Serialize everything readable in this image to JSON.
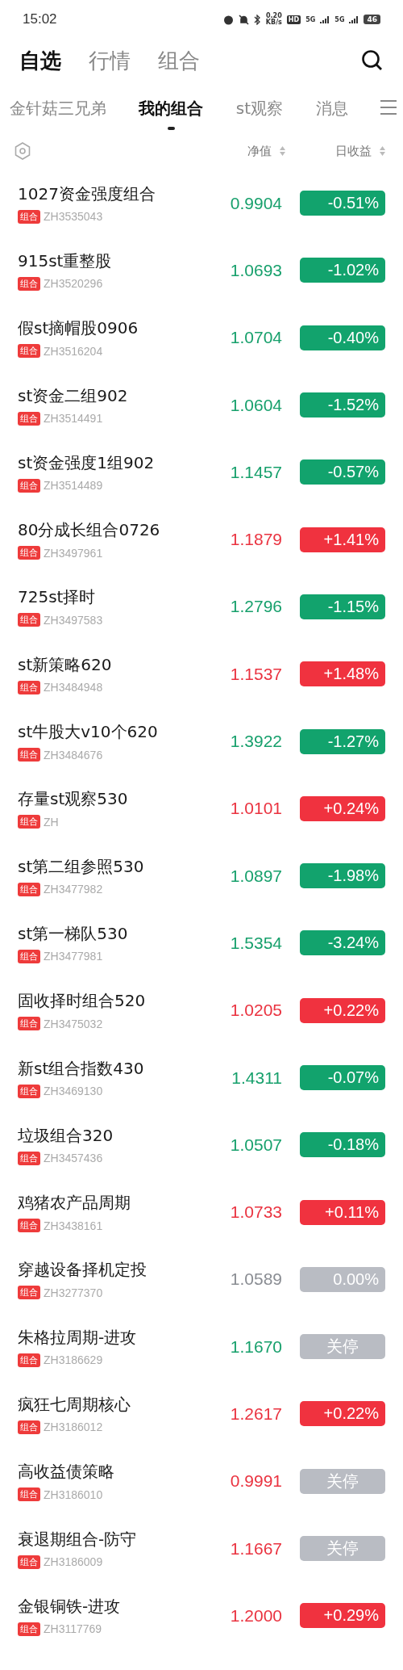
{
  "status_bar": {
    "time": "15:02",
    "speed": "0.20",
    "speed_unit": "KB/s",
    "hd": "HD",
    "sim1": "5G",
    "sim2": "5G",
    "battery": "46"
  },
  "main_tabs": [
    {
      "label": "自选",
      "selected": true
    },
    {
      "label": "行情",
      "selected": false
    },
    {
      "label": "组合",
      "selected": false
    }
  ],
  "sub_tabs": [
    {
      "label": "金针菇三兄弟",
      "selected": false
    },
    {
      "label": "我的组合",
      "selected": true
    },
    {
      "label": "st观察",
      "selected": false
    },
    {
      "label": "消息",
      "selected": false
    }
  ],
  "columns": [
    "净值",
    "日收益"
  ],
  "rows": [
    {
      "name": "1027资金强度组合",
      "tag": "组合",
      "code": "ZH3535043",
      "nav": {
        "text": "0.9904",
        "color": "#17a06c"
      },
      "change": {
        "text": "-0.51%",
        "color": "#12a36d",
        "halted": false
      }
    },
    {
      "name": "915st重整股",
      "tag": "组合",
      "code": "ZH3520296",
      "nav": {
        "text": "1.0693",
        "color": "#17a06c"
      },
      "change": {
        "text": "-1.02%",
        "color": "#12a36d",
        "halted": false
      }
    },
    {
      "name": "假st摘帽股0906",
      "tag": "组合",
      "code": "ZH3516204",
      "nav": {
        "text": "1.0704",
        "color": "#17a06c"
      },
      "change": {
        "text": "-0.40%",
        "color": "#12a36d",
        "halted": false
      }
    },
    {
      "name": "st资金二组902",
      "tag": "组合",
      "code": "ZH3514491",
      "nav": {
        "text": "1.0604",
        "color": "#17a06c"
      },
      "change": {
        "text": "-1.52%",
        "color": "#12a36d",
        "halted": false
      }
    },
    {
      "name": "st资金强度1组902",
      "tag": "组合",
      "code": "ZH3514489",
      "nav": {
        "text": "1.1457",
        "color": "#17a06c"
      },
      "change": {
        "text": "-0.57%",
        "color": "#12a36d",
        "halted": false
      }
    },
    {
      "name": "80分成长组合0726",
      "tag": "组合",
      "code": "ZH3497961",
      "nav": {
        "text": "1.1879",
        "color": "#ea3340"
      },
      "change": {
        "text": "+1.41%",
        "color": "#f0323f",
        "halted": false
      }
    },
    {
      "name": "725st择时",
      "tag": "组合",
      "code": "ZH3497583",
      "nav": {
        "text": "1.2796",
        "color": "#17a06c"
      },
      "change": {
        "text": "-1.15%",
        "color": "#12a36d",
        "halted": false
      }
    },
    {
      "name": "st新策略620",
      "tag": "组合",
      "code": "ZH3484948",
      "nav": {
        "text": "1.1537",
        "color": "#ea3340"
      },
      "change": {
        "text": "+1.48%",
        "color": "#f0323f",
        "halted": false
      }
    },
    {
      "name": "st牛股大v10个620",
      "tag": "组合",
      "code": "ZH3484676",
      "nav": {
        "text": "1.3922",
        "color": "#17a06c"
      },
      "change": {
        "text": "-1.27%",
        "color": "#12a36d",
        "halted": false
      }
    },
    {
      "name": "存量st观察530",
      "tag": "组合",
      "code": "ZH",
      "nav": {
        "text": "1.0101",
        "color": "#ea3340"
      },
      "change": {
        "text": "+0.24%",
        "color": "#f0323f",
        "halted": false
      }
    },
    {
      "name": "st第二组参照530",
      "tag": "组合",
      "code": "ZH3477982",
      "nav": {
        "text": "1.0897",
        "color": "#17a06c"
      },
      "change": {
        "text": "-1.98%",
        "color": "#12a36d",
        "halted": false
      }
    },
    {
      "name": "st第一梯队530",
      "tag": "组合",
      "code": "ZH3477981",
      "nav": {
        "text": "1.5354",
        "color": "#17a06c"
      },
      "change": {
        "text": "-3.24%",
        "color": "#12a36d",
        "halted": false
      }
    },
    {
      "name": "固收择时组合520",
      "tag": "组合",
      "code": "ZH3475032",
      "nav": {
        "text": "1.0205",
        "color": "#ea3340"
      },
      "change": {
        "text": "+0.22%",
        "color": "#f0323f",
        "halted": false
      }
    },
    {
      "name": "新st组合指数430",
      "tag": "组合",
      "code": "ZH3469130",
      "nav": {
        "text": "1.4311",
        "color": "#17a06c"
      },
      "change": {
        "text": "-0.07%",
        "color": "#12a36d",
        "halted": false
      }
    },
    {
      "name": "垃圾组合320",
      "tag": "组合",
      "code": "ZH3457436",
      "nav": {
        "text": "1.0507",
        "color": "#17a06c"
      },
      "change": {
        "text": "-0.18%",
        "color": "#12a36d",
        "halted": false
      }
    },
    {
      "name": "鸡猪农产品周期",
      "tag": "组合",
      "code": "ZH3438161",
      "nav": {
        "text": "1.0733",
        "color": "#ea3340"
      },
      "change": {
        "text": "+0.11%",
        "color": "#f0323f",
        "halted": false
      }
    },
    {
      "name": "穿越设备择机定投",
      "tag": "组合",
      "code": "ZH3277370",
      "nav": {
        "text": "1.0589",
        "color": "#8a8d93"
      },
      "change": {
        "text": "0.00%",
        "color": "#b9bcc3",
        "halted": false
      }
    },
    {
      "name": "朱格拉周期-进攻",
      "tag": "组合",
      "code": "ZH3186629",
      "nav": {
        "text": "1.1670",
        "color": "#17a06c"
      },
      "change": {
        "text": "关停",
        "color": "#b9bcc3",
        "halted": true
      }
    },
    {
      "name": "疯狂七周期核心",
      "tag": "组合",
      "code": "ZH3186012",
      "nav": {
        "text": "1.2617",
        "color": "#ea3340"
      },
      "change": {
        "text": "+0.22%",
        "color": "#f0323f",
        "halted": false
      }
    },
    {
      "name": "高收益债策略",
      "tag": "组合",
      "code": "ZH3186010",
      "nav": {
        "text": "0.9991",
        "color": "#ea3340"
      },
      "change": {
        "text": "关停",
        "color": "#b9bcc3",
        "halted": true
      }
    },
    {
      "name": "衰退期组合-防守",
      "tag": "组合",
      "code": "ZH3186009",
      "nav": {
        "text": "1.1667",
        "color": "#ea3340"
      },
      "change": {
        "text": "关停",
        "color": "#b9bcc3",
        "halted": true
      }
    },
    {
      "name": "金银铜铁-进攻",
      "tag": "组合",
      "code": "ZH3117769",
      "nav": {
        "text": "1.2000",
        "color": "#ea3340"
      },
      "change": {
        "text": "+0.29%",
        "color": "#f0323f",
        "halted": false
      }
    }
  ]
}
